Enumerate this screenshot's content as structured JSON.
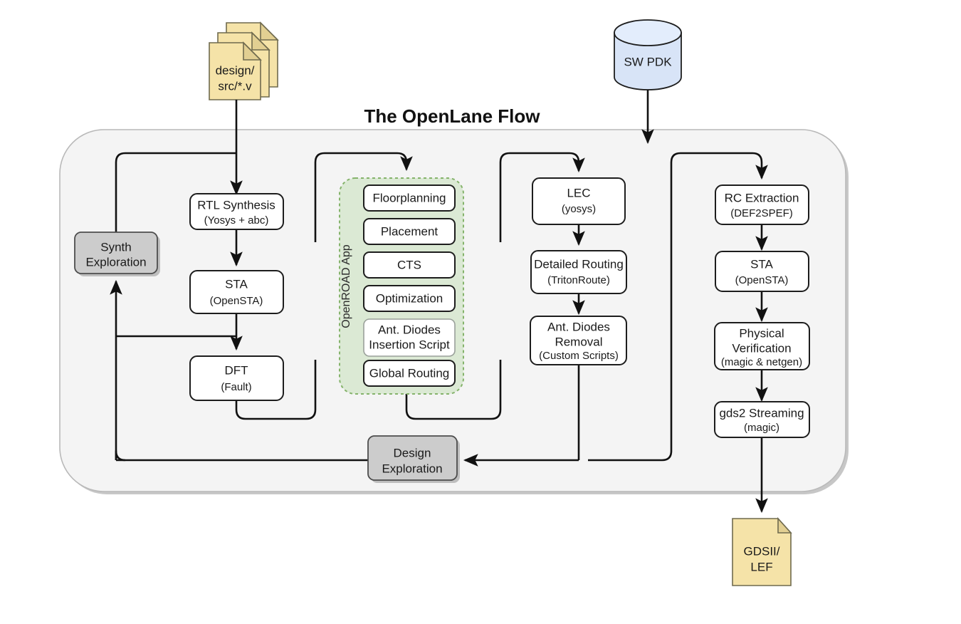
{
  "title": "The OpenLane Flow",
  "inputs": {
    "design_files": {
      "line1": "design/",
      "line2": "src/*.v",
      "icon": "document-stack-icon"
    },
    "pdk": {
      "label": "SW PDK",
      "icon": "database-cylinder-icon"
    }
  },
  "outputs": {
    "gds": {
      "line1": "GDSII/",
      "line2": "LEF",
      "icon": "document-icon"
    }
  },
  "exploration": {
    "synth": {
      "line1": "Synth",
      "line2": "Exploration"
    },
    "design": {
      "line1": "Design",
      "line2": "Exploration"
    }
  },
  "columns": {
    "synthesis": [
      {
        "name": "rtl-synthesis",
        "main": "RTL Synthesis",
        "sub": "(Yosys + abc)"
      },
      {
        "name": "sta-pre",
        "main": "STA",
        "sub": "(OpenSTA)"
      },
      {
        "name": "dft",
        "main": "DFT",
        "sub": "(Fault)"
      }
    ],
    "openroad": {
      "group_label": "OpenROAD App",
      "steps": [
        {
          "name": "floorplanning",
          "main": "Floorplanning",
          "soft": false
        },
        {
          "name": "placement",
          "main": "Placement",
          "soft": false
        },
        {
          "name": "cts",
          "main": "CTS",
          "soft": false
        },
        {
          "name": "optimization",
          "main": "Optimization",
          "soft": false
        },
        {
          "name": "ant-diodes-insertion",
          "main": "Ant. Diodes",
          "main2": "Insertion Script",
          "soft": true
        },
        {
          "name": "global-routing",
          "main": "Global Routing",
          "soft": false
        }
      ]
    },
    "routing": [
      {
        "name": "lec",
        "main": "LEC",
        "sub": "(yosys)"
      },
      {
        "name": "detailed-routing",
        "main": "Detailed Routing",
        "sub": "(TritonRoute)"
      },
      {
        "name": "ant-diodes-removal",
        "main": "Ant. Diodes",
        "main2": "Removal",
        "sub": "(Custom Scripts)"
      }
    ],
    "signoff": [
      {
        "name": "rc-extraction",
        "main": "RC Extraction",
        "sub": "(DEF2SPEF)"
      },
      {
        "name": "sta-post",
        "main": "STA",
        "sub": "(OpenSTA)"
      },
      {
        "name": "physical-verification",
        "main": "Physical",
        "main2": "Verification",
        "sub": "(magic & netgen)"
      },
      {
        "name": "gds2-streaming",
        "main": "gds2 Streaming",
        "sub": "(magic)"
      }
    ]
  },
  "colors": {
    "canvas": "#ffffff",
    "shell_fill": "#f4f4f4",
    "shell_stroke": "#b9b9b9",
    "openroad_fill": "#dbe9d4",
    "openroad_stroke": "#85b36b",
    "document_fill": "#f5e3a8",
    "pdk_fill": "#d8e4f7",
    "gray_box_fill": "#cccccc",
    "line": "#111111"
  }
}
